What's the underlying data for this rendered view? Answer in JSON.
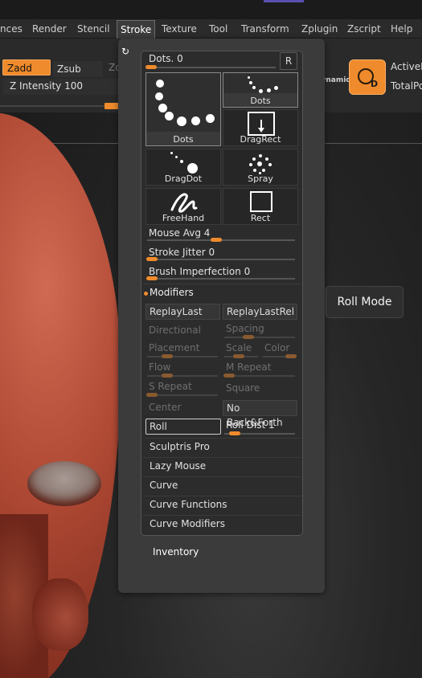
{
  "menubar": {
    "items": [
      "nces",
      "Render",
      "Stencil",
      "Stroke",
      "Texture",
      "Tool",
      "Transform",
      "Zplugin",
      "Zscript",
      "Help"
    ],
    "active": "Stroke"
  },
  "toolbar": {
    "zadd": "Zadd",
    "zsub": "Zsub",
    "zcut": "Zcut",
    "zintensity": "Z Intensity 100",
    "dynamic": "Dynamic",
    "dynamic_letter": "D",
    "active_label": "ActiveP",
    "total_label": "TotalPo"
  },
  "stroke": {
    "dots_slider": "Dots. 0",
    "r_button": "R",
    "tiles": [
      "Dots",
      "Dots",
      "DragRect",
      "DragDot",
      "Spray",
      "FreeHand",
      "Rect"
    ],
    "mouse_avg": "Mouse Avg 4",
    "stroke_jitter": "Stroke Jitter 0",
    "brush_imperfection": "Brush Imperfection 0",
    "modifiers_header": "Modifiers",
    "replay_last": "ReplayLast",
    "replay_last_rel": "ReplayLastRel",
    "directional": "Directional",
    "spacing": "Spacing",
    "placement": "Placement",
    "scale": "Scale",
    "color": "Color",
    "flow": "Flow",
    "m_repeat": "M Repeat",
    "s_repeat": "S Repeat",
    "square": "Square",
    "center": "Center",
    "no_back_forth": "No Back&Forth",
    "roll": "Roll",
    "roll_dist": "Roll Dist 1",
    "sculptris_pro": "Sculptris Pro",
    "lazy_mouse": "Lazy Mouse",
    "curve": "Curve",
    "curve_functions": "Curve Functions",
    "curve_modifiers": "Curve Modifiers",
    "inventory": "Inventory"
  },
  "tooltip": {
    "text": "Roll Mode"
  },
  "colors": {
    "accent": "#ef8b2c",
    "panel": "#2c2c2c",
    "palette": "#3b3b3b"
  }
}
